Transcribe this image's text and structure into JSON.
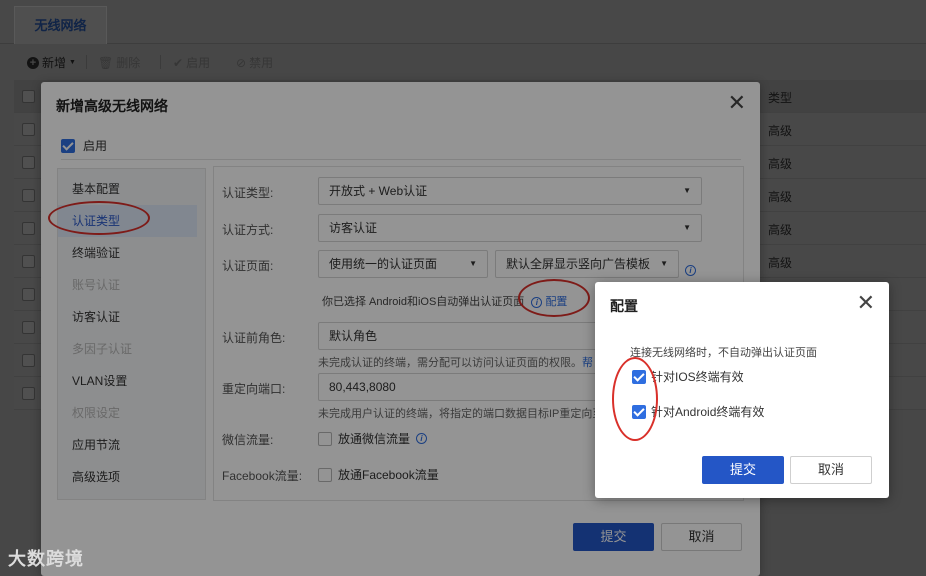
{
  "background": {
    "tab_label": "无线网络",
    "toolbar": {
      "new_label": "新增",
      "delete_label": "删除",
      "enable_label": "启用",
      "disable_label": "禁用"
    },
    "table_header_type": "类型",
    "row_types": [
      "高级",
      "高级",
      "高级",
      "高级",
      "高级"
    ]
  },
  "modal": {
    "title": "新增高级无线网络",
    "enable_label": "启用",
    "sidebar": [
      {
        "label": "基本配置",
        "state": "normal"
      },
      {
        "label": "认证类型",
        "state": "active"
      },
      {
        "label": "终端验证",
        "state": "normal"
      },
      {
        "label": "账号认证",
        "state": "disabled"
      },
      {
        "label": "访客认证",
        "state": "normal"
      },
      {
        "label": "多因子认证",
        "state": "disabled"
      },
      {
        "label": "VLAN设置",
        "state": "normal"
      },
      {
        "label": "权限设定",
        "state": "disabled"
      },
      {
        "label": "应用节流",
        "state": "normal"
      },
      {
        "label": "高级选项",
        "state": "normal"
      }
    ],
    "form": {
      "auth_type_label": "认证类型:",
      "auth_type_value": "开放式 + Web认证",
      "auth_method_label": "认证方式:",
      "auth_method_value": "访客认证",
      "auth_page_label": "认证页面:",
      "auth_page_value": "使用统一的认证页面",
      "auth_template_value": "默认全屏显示竖向广告模板",
      "popup_note": "你已选择 Android和iOS自动弹出认证页面",
      "config_link": "配置",
      "pre_role_label": "认证前角色:",
      "pre_role_value": "默认角色",
      "pre_role_hint": "未完成认证的终端，需分配可以访问认证页面的权限。",
      "pre_role_hint_link": "帮",
      "redirect_label": "重定向端口:",
      "redirect_value": "80,443,8080",
      "redirect_hint": "未完成用户认证的终端，将指定的端口数据目标IP重定向至",
      "wechat_label": "微信流量:",
      "wechat_option": "放通微信流量",
      "facebook_label": "Facebook流量:",
      "facebook_option": "放通Facebook流量"
    },
    "submit_label": "提交",
    "cancel_label": "取消"
  },
  "popup": {
    "title": "配置",
    "description": "连接无线网络时，不自动弹出认证页面",
    "ios_label": "针对IOS终端有效",
    "android_label": "针对Android终端有效",
    "ios_checked": true,
    "android_checked": true,
    "submit_label": "提交",
    "cancel_label": "取消"
  },
  "watermark": "大数跨境",
  "colors": {
    "primary": "#2456c6",
    "link": "#2f6ee0",
    "annotation": "#d9302a"
  }
}
